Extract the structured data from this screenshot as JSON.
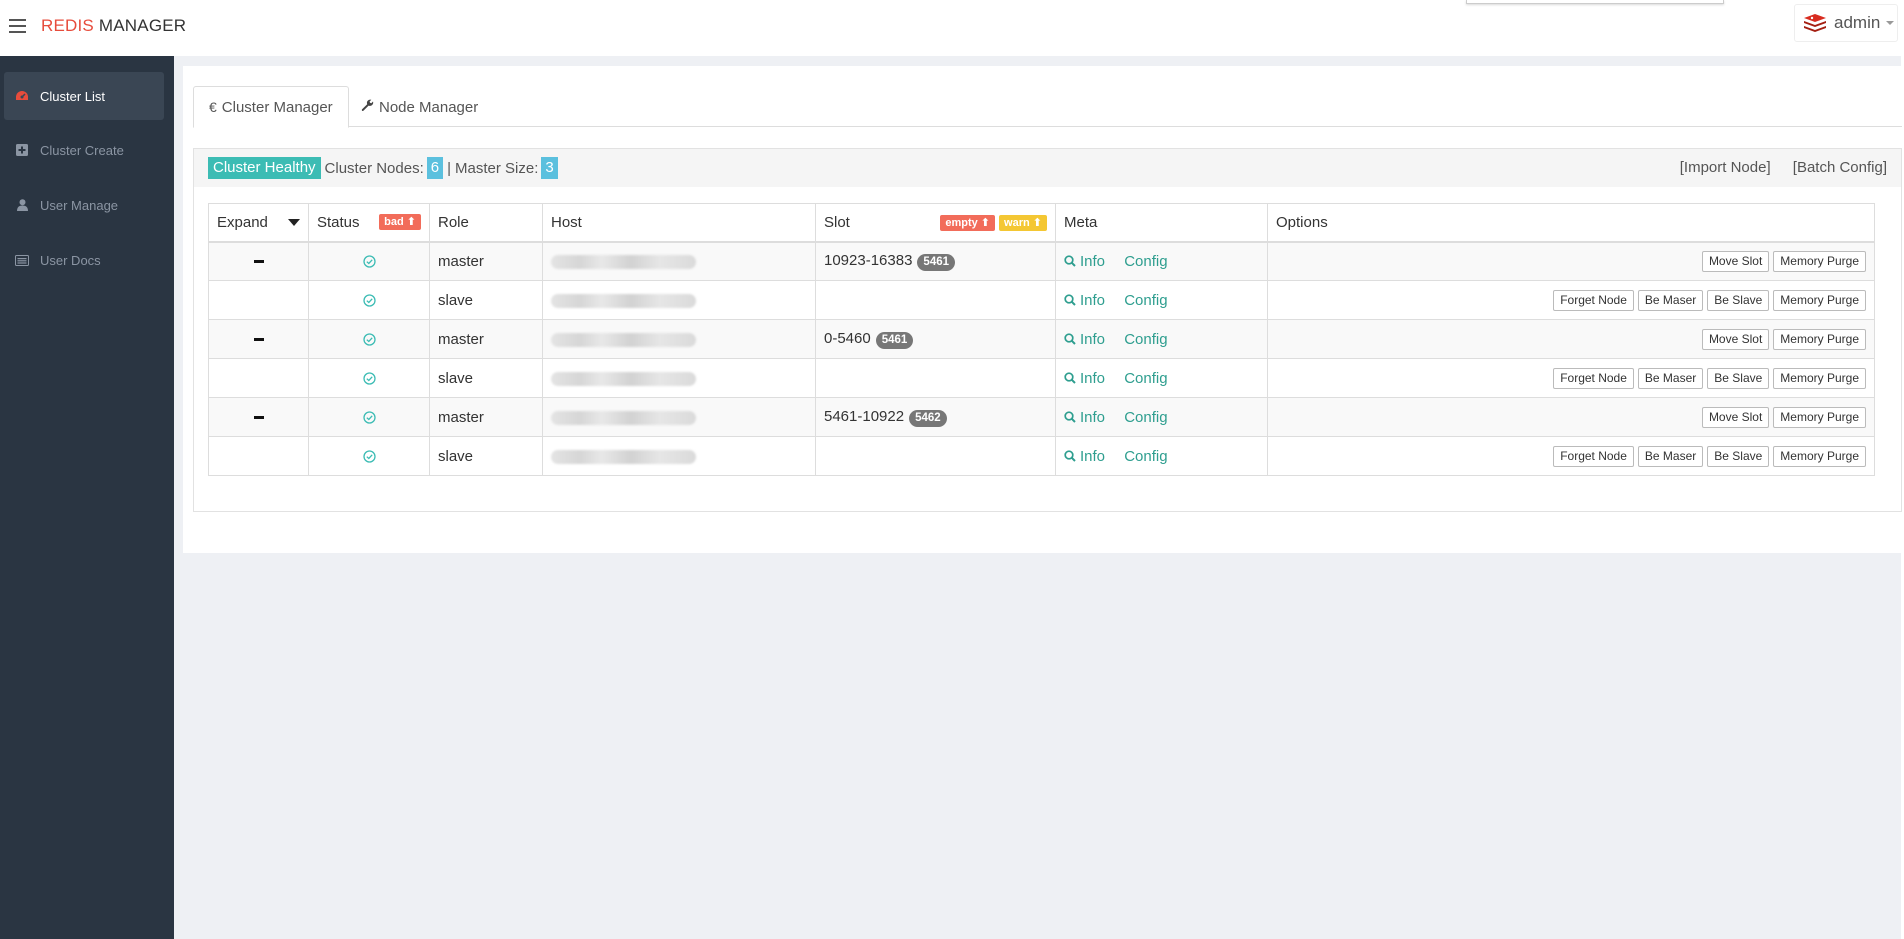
{
  "header": {
    "brand_part1": "REDIS",
    "brand_part2": "MANAGER",
    "username": "admin"
  },
  "sidebar": {
    "items": [
      {
        "label": "Cluster List",
        "icon": "dashboard-icon",
        "active": true
      },
      {
        "label": "Cluster Create",
        "icon": "plus-square-icon"
      },
      {
        "label": "User Manage",
        "icon": "user-icon"
      },
      {
        "label": "User Docs",
        "icon": "list-icon"
      }
    ]
  },
  "tabs": [
    {
      "label": "Cluster Manager",
      "icon": "euro-icon"
    },
    {
      "label": "Node Manager",
      "icon": "wrench-icon"
    }
  ],
  "summary": {
    "health": "Cluster Healthy",
    "nodes_label": "Cluster Nodes:",
    "nodes_count": "6",
    "separator": "|",
    "master_label": "Master Size:",
    "master_count": "3",
    "import_node": "[Import Node]",
    "batch_config": "[Batch Config]"
  },
  "table": {
    "headers": {
      "expand": "Expand",
      "status": "Status",
      "status_badge": "bad",
      "role": "Role",
      "host": "Host",
      "slot": "Slot",
      "slot_badge_empty": "empty",
      "slot_badge_warn": "warn",
      "meta": "Meta",
      "options": "Options"
    },
    "meta_info": "Info",
    "meta_config": "Config",
    "rows": [
      {
        "role": "master",
        "slot": "10923-16383",
        "slot_count": "5461",
        "buttons": [
          "Move Slot",
          "Memory Purge"
        ]
      },
      {
        "role": "slave",
        "slot": "",
        "slot_count": "",
        "buttons": [
          "Forget Node",
          "Be Maser",
          "Be Slave",
          "Memory Purge"
        ]
      },
      {
        "role": "master",
        "slot": "0-5460",
        "slot_count": "5461",
        "buttons": [
          "Move Slot",
          "Memory Purge"
        ]
      },
      {
        "role": "slave",
        "slot": "",
        "slot_count": "",
        "buttons": [
          "Forget Node",
          "Be Maser",
          "Be Slave",
          "Memory Purge"
        ]
      },
      {
        "role": "master",
        "slot": "5461-10922",
        "slot_count": "5462",
        "buttons": [
          "Move Slot",
          "Memory Purge"
        ]
      },
      {
        "role": "slave",
        "slot": "",
        "slot_count": "",
        "buttons": [
          "Forget Node",
          "Be Maser",
          "Be Slave",
          "Memory Purge"
        ]
      }
    ]
  },
  "colors": {
    "accent_red": "#e74c3c",
    "healthy": "#3cbcb4",
    "info_blue": "#5bc0de",
    "link_teal": "#2e9e8f",
    "sidebar_bg": "#2a3542"
  }
}
